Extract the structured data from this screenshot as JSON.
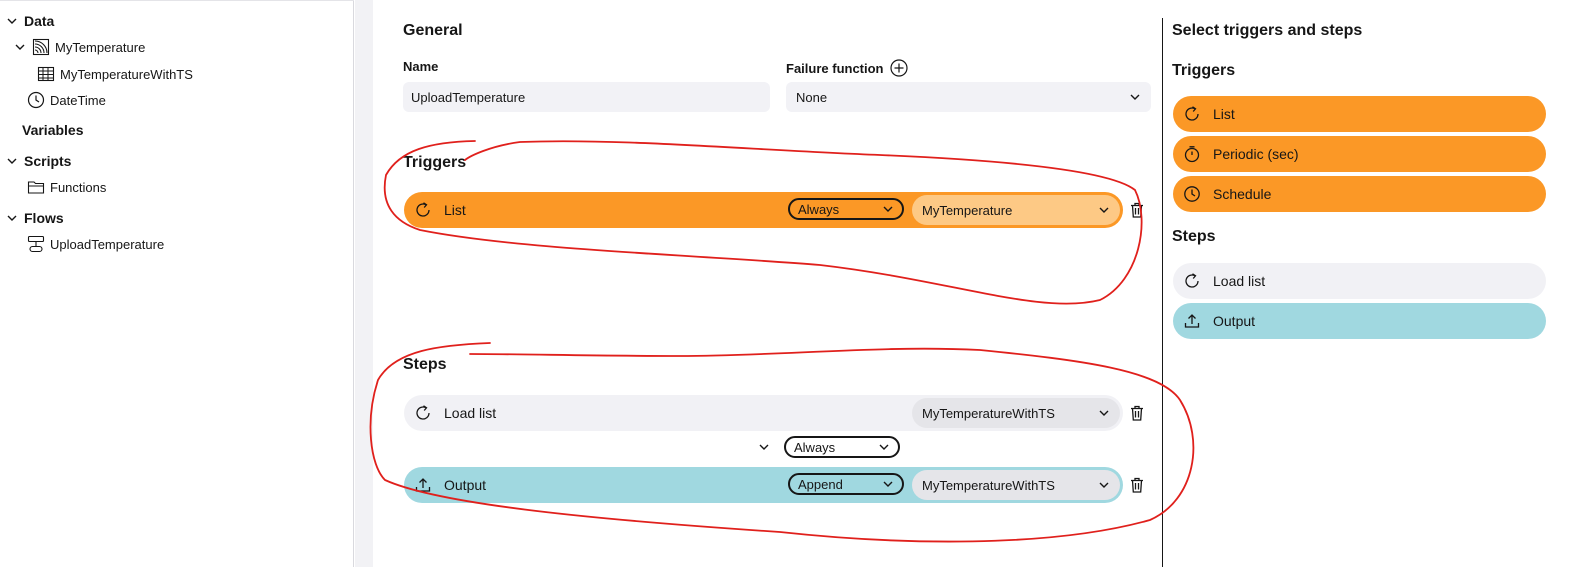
{
  "sidebar": {
    "groups": [
      {
        "label": "Data"
      },
      {
        "label": "Variables"
      },
      {
        "label": "Scripts"
      },
      {
        "label": "Flows"
      }
    ],
    "items": {
      "my_temperature": "MyTemperature",
      "my_temperature_with_ts": "MyTemperatureWithTS",
      "datetime": "DateTime",
      "functions": "Functions",
      "upload_temperature": "UploadTemperature"
    }
  },
  "general": {
    "title": "General",
    "name_label": "Name",
    "name_value": "UploadTemperature",
    "failure_label": "Failure function",
    "failure_value": "None"
  },
  "triggers": {
    "title": "Triggers",
    "items": [
      {
        "label": "List",
        "condition": "Always",
        "source": "MyTemperature"
      }
    ]
  },
  "steps": {
    "title": "Steps",
    "items": [
      {
        "label": "Load list",
        "source": "MyTemperatureWithTS"
      },
      {
        "label": "Output",
        "mode": "Append",
        "target": "MyTemperatureWithTS"
      }
    ],
    "connector_condition": "Always"
  },
  "palette": {
    "title": "Select triggers and steps",
    "triggers_title": "Triggers",
    "triggers": [
      "List",
      "Periodic (sec)",
      "Schedule"
    ],
    "steps_title": "Steps",
    "steps": [
      "Load list",
      "Output"
    ]
  },
  "colors": {
    "trigger": "#fb9826",
    "trigger_select": "#fdc985",
    "step_load": "#f1f1f5",
    "step_output": "#a0d8e0",
    "annotation": "#e0201c"
  },
  "icons": {
    "refresh": "refresh-icon",
    "timer": "timer-icon",
    "clock": "clock-icon",
    "upload": "upload-icon",
    "trash": "trash-icon",
    "plus": "plus-circle-icon"
  }
}
